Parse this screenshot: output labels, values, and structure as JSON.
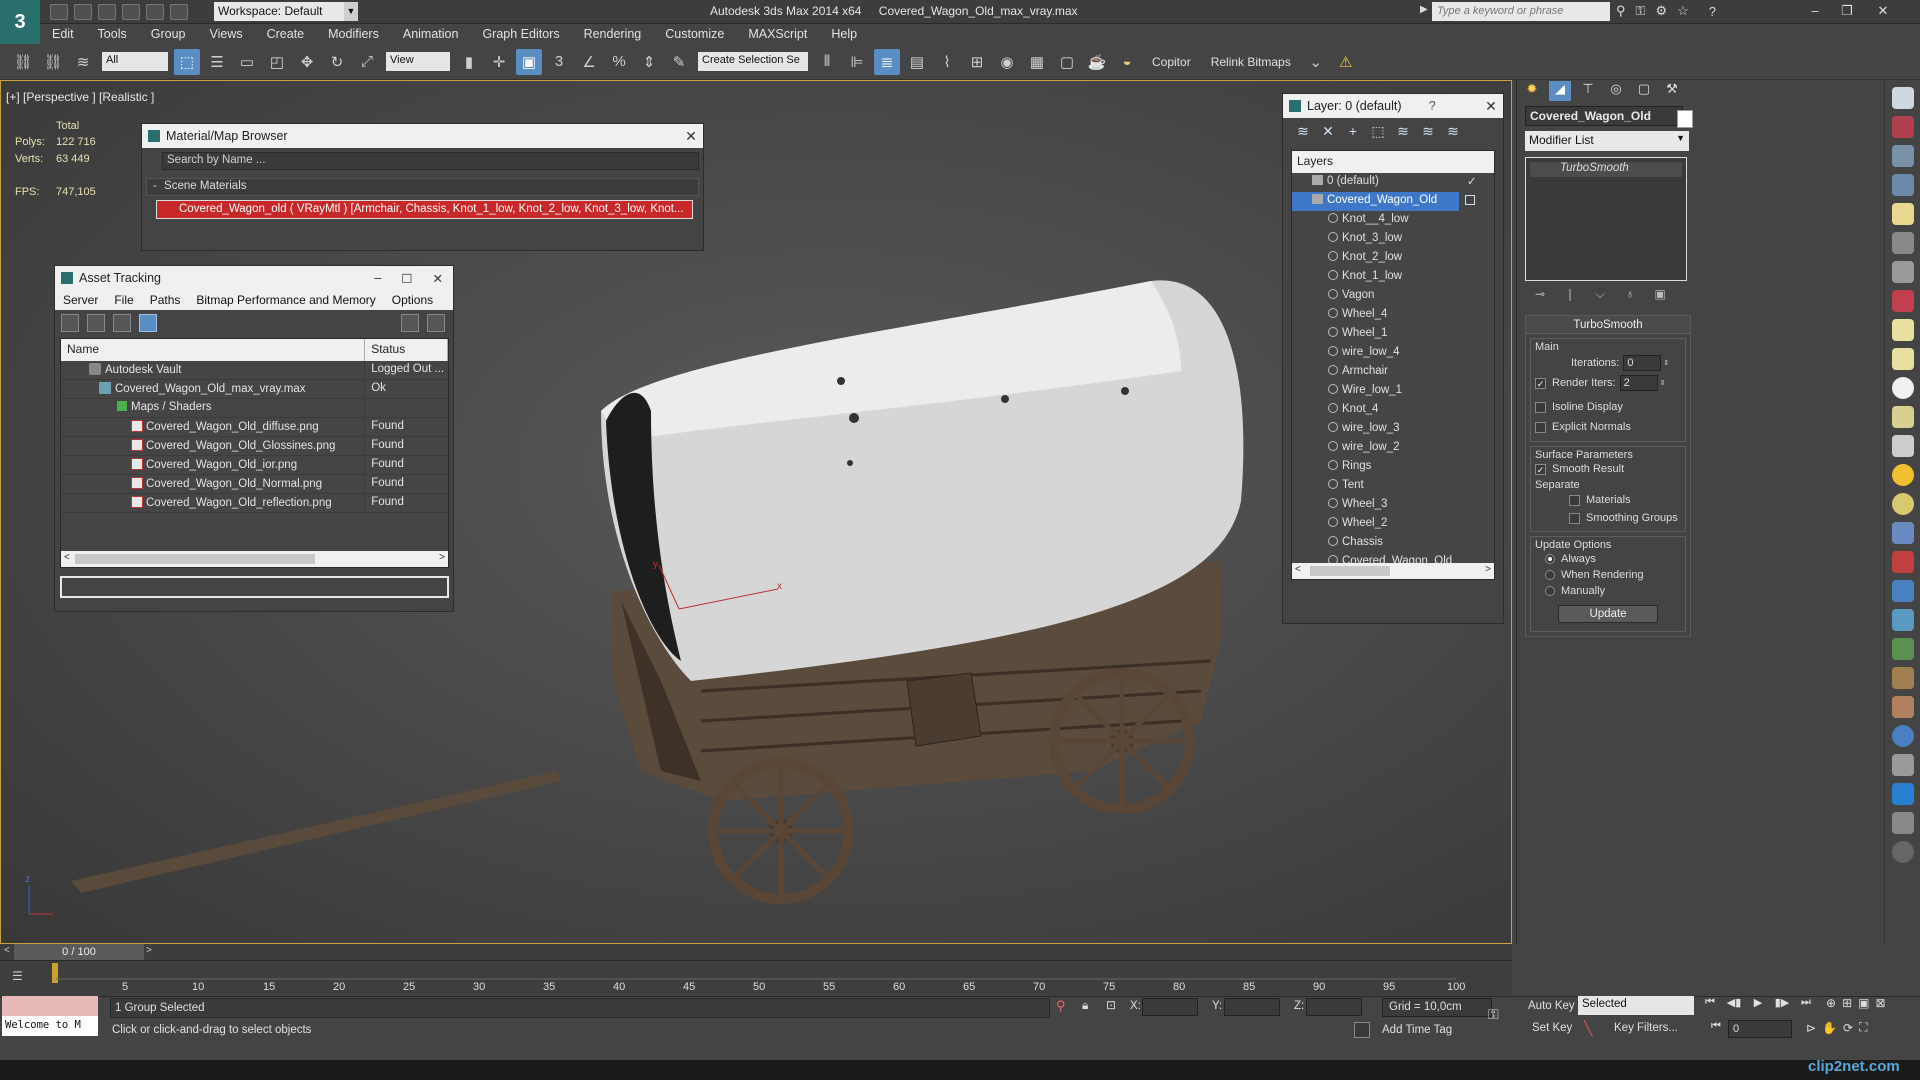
{
  "titlebar": {
    "workspace": "Workspace: Default",
    "app": "Autodesk 3ds Max  2014 x64",
    "file": "Covered_Wagon_Old_max_vray.max",
    "search_placeholder": "Type a keyword or phrase"
  },
  "menu": [
    "Edit",
    "Tools",
    "Group",
    "Views",
    "Create",
    "Modifiers",
    "Animation",
    "Graph Editors",
    "Rendering",
    "Customize",
    "MAXScript",
    "Help"
  ],
  "toolbar": {
    "filter": "All",
    "ref_coord": "View",
    "selection_set": "Create Selection Se",
    "copitor": "Copitor",
    "relink": "Relink Bitmaps"
  },
  "viewport": {
    "label": "[+] [Perspective ] [Realistic ]",
    "stats": {
      "total_label": "Total",
      "polys_label": "Polys:",
      "polys": "122 716",
      "verts_label": "Verts:",
      "verts": "63 449",
      "fps_label": "FPS:",
      "fps": "747,105"
    },
    "axis_x": "x",
    "axis_y": "y",
    "axis_z": "z"
  },
  "material_browser": {
    "title": "Material/Map Browser",
    "search": "Search by Name ...",
    "section": "Scene Materials",
    "item": "Covered_Wagon_old  ( VRayMtl ) [Armchair, Chassis, Knot_1_low, Knot_2_low, Knot_3_low, Knot..."
  },
  "asset_tracking": {
    "title": "Asset Tracking",
    "menu": [
      "Server",
      "File",
      "Paths",
      "Bitmap Performance and Memory",
      "Options"
    ],
    "columns": [
      "Name",
      "Status"
    ],
    "rows": [
      {
        "name": "Autodesk Vault",
        "status": "Logged Out ..."
      },
      {
        "name": "Covered_Wagon_Old_max_vray.max",
        "status": "Ok"
      },
      {
        "name": "Maps / Shaders",
        "status": ""
      },
      {
        "name": "Covered_Wagon_Old_diffuse.png",
        "status": "Found"
      },
      {
        "name": "Covered_Wagon_Old_Glossines.png",
        "status": "Found"
      },
      {
        "name": "Covered_Wagon_Old_ior.png",
        "status": "Found"
      },
      {
        "name": "Covered_Wagon_Old_Normal.png",
        "status": "Found"
      },
      {
        "name": "Covered_Wagon_Old_reflection.png",
        "status": "Found"
      }
    ]
  },
  "layer_panel": {
    "title": "Layer: 0 (default)",
    "header": "Layers",
    "layers": [
      "0 (default)",
      "Covered_Wagon_Old"
    ],
    "objects": [
      "Knot__4_low",
      "Knot_3_low",
      "Knot_2_low",
      "Knot_1_low",
      "Vagon",
      "Wheel_4",
      "Wheel_1",
      "wire_low_4",
      "Armchair",
      "Wire_low_1",
      "Knot_4",
      "wire_low_3",
      "wire_low_2",
      "Rings",
      "Tent",
      "Wheel_3",
      "Wheel_2",
      "Chassis",
      "Covered_Wagon_Old"
    ]
  },
  "command_panel": {
    "object_name": "Covered_Wagon_Old",
    "modifier_list": "Modifier List",
    "modifier": "TurboSmooth",
    "rollout_title": "TurboSmooth",
    "main": "Main",
    "iterations_label": "Iterations:",
    "iterations": "0",
    "render_iters_label": "Render Iters:",
    "render_iters": "2",
    "isoline": "Isoline Display",
    "explicit": "Explicit Normals",
    "surface": "Surface Parameters",
    "smooth_result": "Smooth Result",
    "separate": "Separate",
    "materials": "Materials",
    "smoothing_groups": "Smoothing Groups",
    "update_options": "Update Options",
    "always": "Always",
    "when_rendering": "When Rendering",
    "manually": "Manually",
    "update": "Update"
  },
  "timeline": {
    "slider": "0 / 100",
    "ticks": [
      "5",
      "10",
      "15",
      "20",
      "25",
      "30",
      "35",
      "40",
      "45",
      "50",
      "55",
      "60",
      "65",
      "70",
      "75",
      "80",
      "85",
      "90",
      "95",
      "100"
    ]
  },
  "status": {
    "maxscript": "Welcome to M",
    "selection": "1 Group Selected",
    "prompt": "Click or click-and-drag to select objects",
    "x_label": "X:",
    "y_label": "Y:",
    "z_label": "Z:",
    "grid": "Grid = 10,0cm",
    "add_time_tag": "Add Time Tag",
    "auto_key": "Auto Key",
    "set_key": "Set Key",
    "selected": "Selected",
    "key_filters": "Key Filters...",
    "frame": "0"
  },
  "watermark": "clip2net.com"
}
